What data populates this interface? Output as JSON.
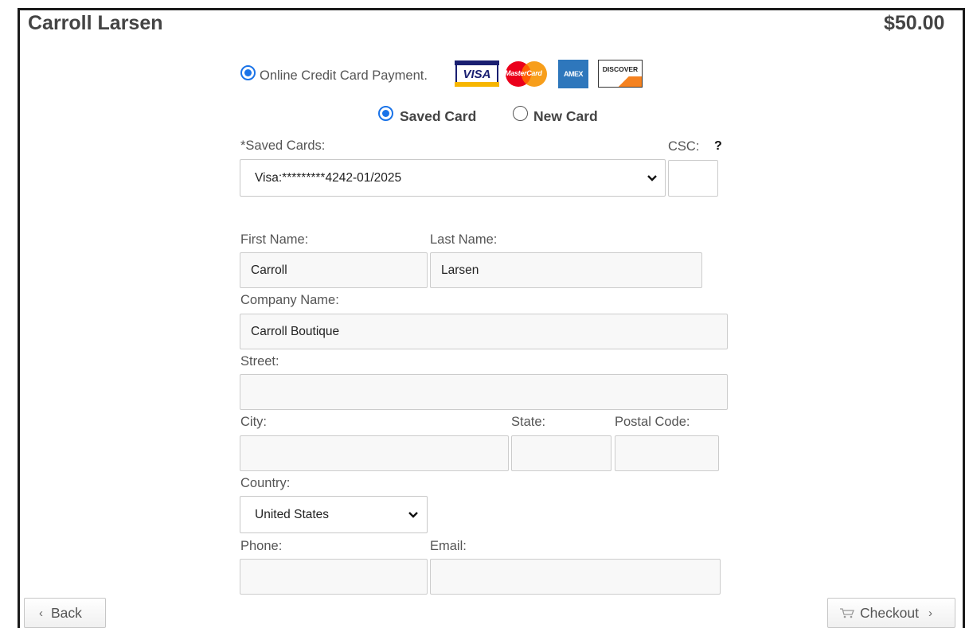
{
  "header": {
    "customer_name": "Carroll Larsen",
    "amount": "$50.00"
  },
  "payment_method": {
    "label": "Online Credit Card Payment.",
    "card_brands": [
      {
        "name": "VISA",
        "icon": "visa-card-icon",
        "color": "#1a1f71"
      },
      {
        "name": "MasterCard",
        "icon": "mastercard-icon",
        "color": "#eb001b"
      },
      {
        "name": "AMEX",
        "icon": "amex-card-icon",
        "color": "#2e77bc"
      },
      {
        "name": "DISCOVER",
        "icon": "discover-card-icon",
        "color": "#f58220"
      }
    ]
  },
  "card_choice": {
    "saved_label": "Saved Card",
    "new_label": "New Card",
    "selected": "Saved Card"
  },
  "saved_cards": {
    "label": "*Saved Cards:",
    "selected_value": "Visa:*********4242-01/2025"
  },
  "csc": {
    "label": "CSC:",
    "help": "?",
    "value": ""
  },
  "form": {
    "first_name_label": "First Name:",
    "first_name": "Carroll",
    "last_name_label": "Last Name:",
    "last_name": "Larsen",
    "company_label": "Company Name:",
    "company": "Carroll Boutique",
    "street_label": "Street:",
    "street": "",
    "city_label": "City:",
    "city": "",
    "state_label": "State:",
    "state": "",
    "postal_label": "Postal Code:",
    "postal": "",
    "country_label": "Country:",
    "country": "United States",
    "phone_label": "Phone:",
    "phone": "",
    "email_label": "Email:",
    "email": ""
  },
  "footer": {
    "back_label": "Back",
    "checkout_label": "Checkout"
  },
  "colors": {
    "accent": "#1a73e8",
    "field_bg": "#f8f8f8",
    "border": "#cccccc"
  }
}
